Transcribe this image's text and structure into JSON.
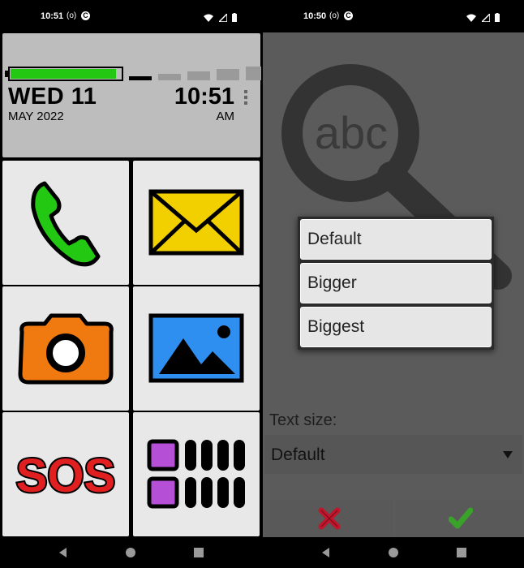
{
  "left": {
    "status": {
      "time": "10:51",
      "icons": [
        "broadcast-icon",
        "c-app-icon",
        "wifi-icon",
        "cell-signal-icon",
        "battery-icon"
      ]
    },
    "clock": {
      "day": "WED 11",
      "month_year": "MAY 2022",
      "time": "10:51",
      "ampm": "AM",
      "battery_level": 0.97,
      "signal_bars": 1,
      "battery_color": "#22c811"
    },
    "tiles": [
      {
        "icon": "phone-icon",
        "color": "#22c811"
      },
      {
        "icon": "mail-icon",
        "color": "#f2d000"
      },
      {
        "icon": "camera-icon",
        "color": "#f07a10"
      },
      {
        "icon": "gallery-icon",
        "color": "#2f8ff0"
      },
      {
        "icon": "sos-icon",
        "text": "SOS",
        "color": "#e02020"
      },
      {
        "icon": "app-grid-icon",
        "color": "#b44fd6"
      }
    ]
  },
  "right": {
    "status": {
      "time": "10:50",
      "icons": [
        "broadcast-icon",
        "c-app-icon",
        "wifi-icon",
        "cell-signal-icon",
        "battery-icon"
      ]
    },
    "magnifier_text": "abc",
    "menu": [
      "Default",
      "Bigger",
      "Biggest"
    ],
    "setting": {
      "label": "Text size:",
      "value": "Default"
    },
    "actions": {
      "cancel": "cancel-icon",
      "confirm": "confirm-icon",
      "cancel_color": "#c0152b",
      "confirm_color": "#3aa12a"
    }
  },
  "nav": {
    "icons": [
      "back-icon",
      "home-icon",
      "recents-icon"
    ]
  }
}
